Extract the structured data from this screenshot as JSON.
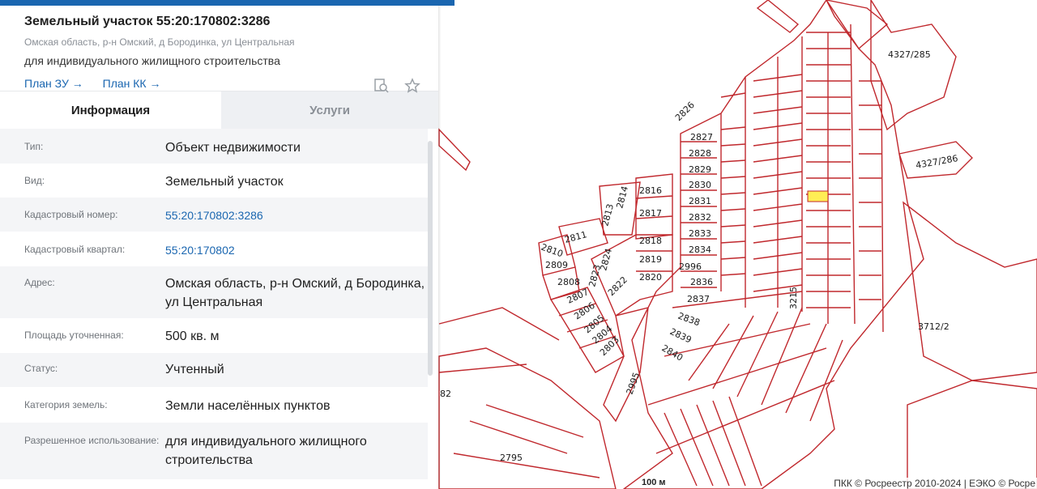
{
  "panel": {
    "title": "Земельный участок 55:20:170802:3286",
    "address_line": "Омская область, р-н Омский, д Бородинка, ул Центральная",
    "permitted_use": "для индивидуального жилищного строительства",
    "links": [
      {
        "label": "План ЗУ"
      },
      {
        "label": "План КК"
      }
    ],
    "icons": [
      "document-search-icon",
      "star-icon"
    ],
    "tabs": [
      {
        "label": "Информация",
        "active": true
      },
      {
        "label": "Услуги",
        "active": false
      }
    ],
    "rows": [
      {
        "key": "Тип:",
        "value": "Объект недвижимости",
        "link": false
      },
      {
        "key": "Вид:",
        "value": "Земельный участок",
        "link": false
      },
      {
        "key": "Кадастровый номер:",
        "value": "55:20:170802:3286",
        "link": true
      },
      {
        "key": "Кадастровый квартал:",
        "value": "55:20:170802",
        "link": true
      },
      {
        "key": "Адрес:",
        "value": "Омская область, р-н Омский, д Бородинка, ул Центральная",
        "link": false
      },
      {
        "key": "Площадь уточненная:",
        "value": "500 кв. м",
        "link": false
      },
      {
        "key": "Статус:",
        "value": "Учтенный",
        "link": false
      },
      {
        "key": "Категория земель:",
        "value": "Земли населённых пунктов",
        "link": false
      },
      {
        "key": "Разрешенное использование:",
        "value": "для индивидуального жилищного строительства",
        "link": false
      }
    ]
  },
  "map": {
    "parcel_labels": [
      "2826",
      "2827",
      "2828",
      "2829",
      "2830",
      "2831",
      "2832",
      "2833",
      "2834",
      "2996",
      "2836",
      "2837",
      "2838",
      "2839",
      "2840",
      "2816",
      "2817",
      "2814",
      "2813",
      "2818",
      "2819",
      "2820",
      "2824",
      "2823",
      "2822",
      "2811",
      "2810",
      "2809",
      "2808",
      "2807",
      "2806",
      "2805",
      "2804",
      "2803",
      "2995",
      "2795",
      "3215",
      "4327/285",
      "4327/286",
      "3712/2",
      "82"
    ],
    "scale_label": "100 м",
    "copyright": "ПКК © Росреестр 2010-2024 | ЕЭКО © Росре",
    "colors": {
      "parcel_border": "#c0282d",
      "selected_parcel": "#ffee55"
    }
  }
}
